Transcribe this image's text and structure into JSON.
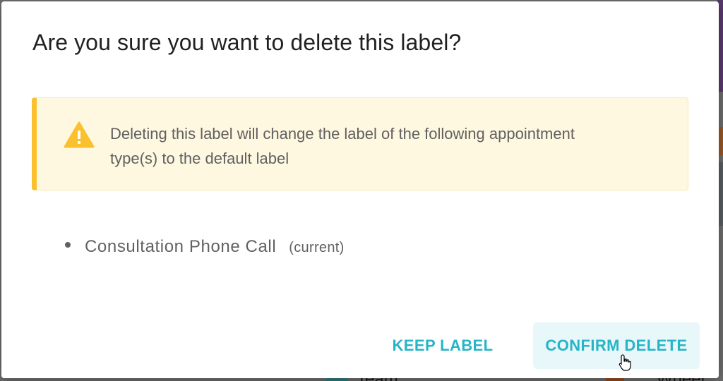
{
  "dialog": {
    "title": "Are you sure you want to delete this label?",
    "warning": {
      "icon": "warning-icon",
      "text": "Deleting this label will change the label of the following appointment type(s) to the default label"
    },
    "appointment_types": [
      {
        "name": "Consultation Phone Call",
        "tag": "(current)"
      }
    ],
    "buttons": {
      "keep": "KEEP LABEL",
      "confirm": "CONFIRM DELETE"
    }
  },
  "background": {
    "snippet_1": "Team",
    "snippet_2": "Wheel"
  },
  "colors": {
    "accent": "#26b4c6",
    "warning_bg": "#fff8e1",
    "warning_border": "#fbc02d",
    "text_primary": "#212121",
    "text_secondary": "#616161"
  }
}
